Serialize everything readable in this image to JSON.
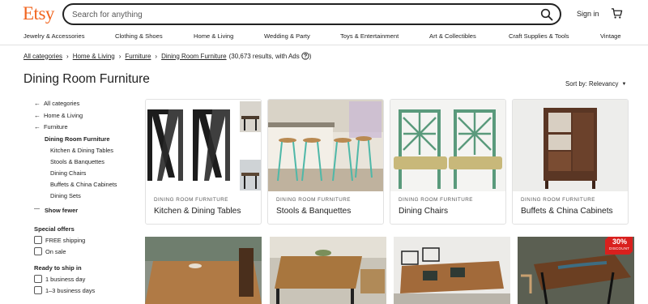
{
  "header": {
    "logo": "Etsy",
    "search_placeholder": "Search for anything",
    "signin_label": "Sign in",
    "search_icon": "search-icon",
    "cart_icon": "cart-icon"
  },
  "categories": [
    "Jewelry & Accessories",
    "Clothing & Shoes",
    "Home & Living",
    "Wedding & Party",
    "Toys & Entertainment",
    "Art & Collectibles",
    "Craft Supplies & Tools",
    "Vintage"
  ],
  "breadcrumb": {
    "items": [
      "All categories",
      "Home & Living",
      "Furniture",
      "Dining Room Furniture"
    ],
    "count": "(30,673 results, with Ads",
    "count_close": ")"
  },
  "page": {
    "title": "Dining Room Furniture",
    "sort_label": "Sort by: Relevancy"
  },
  "sidebar": {
    "back_links": [
      "All categories",
      "Home & Living",
      "Furniture"
    ],
    "current": "Dining Room Furniture",
    "subcategories": [
      "Kitchen & Dining Tables",
      "Stools & Banquettes",
      "Dining Chairs",
      "Buffets & China Cabinets",
      "Dining Sets"
    ],
    "show_fewer": "Show fewer",
    "special_offers": {
      "title": "Special offers",
      "options": [
        "FREE shipping",
        "On sale"
      ]
    },
    "ready_to_ship": {
      "title": "Ready to ship in",
      "options": [
        "1 business day",
        "1–3 business days"
      ]
    }
  },
  "cards": [
    {
      "category": "DINING ROOM FURNITURE",
      "name": "Kitchen & Dining Tables"
    },
    {
      "category": "DINING ROOM FURNITURE",
      "name": "Stools & Banquettes"
    },
    {
      "category": "DINING ROOM FURNITURE",
      "name": "Dining Chairs"
    },
    {
      "category": "DINING ROOM FURNITURE",
      "name": "Buffets & China Cabinets"
    }
  ],
  "listing_badge": {
    "percent": "30%",
    "label": "DISCOUNT"
  },
  "colors": {
    "brand": "#f1641e",
    "text": "#222222",
    "border": "#e1e1e1"
  }
}
